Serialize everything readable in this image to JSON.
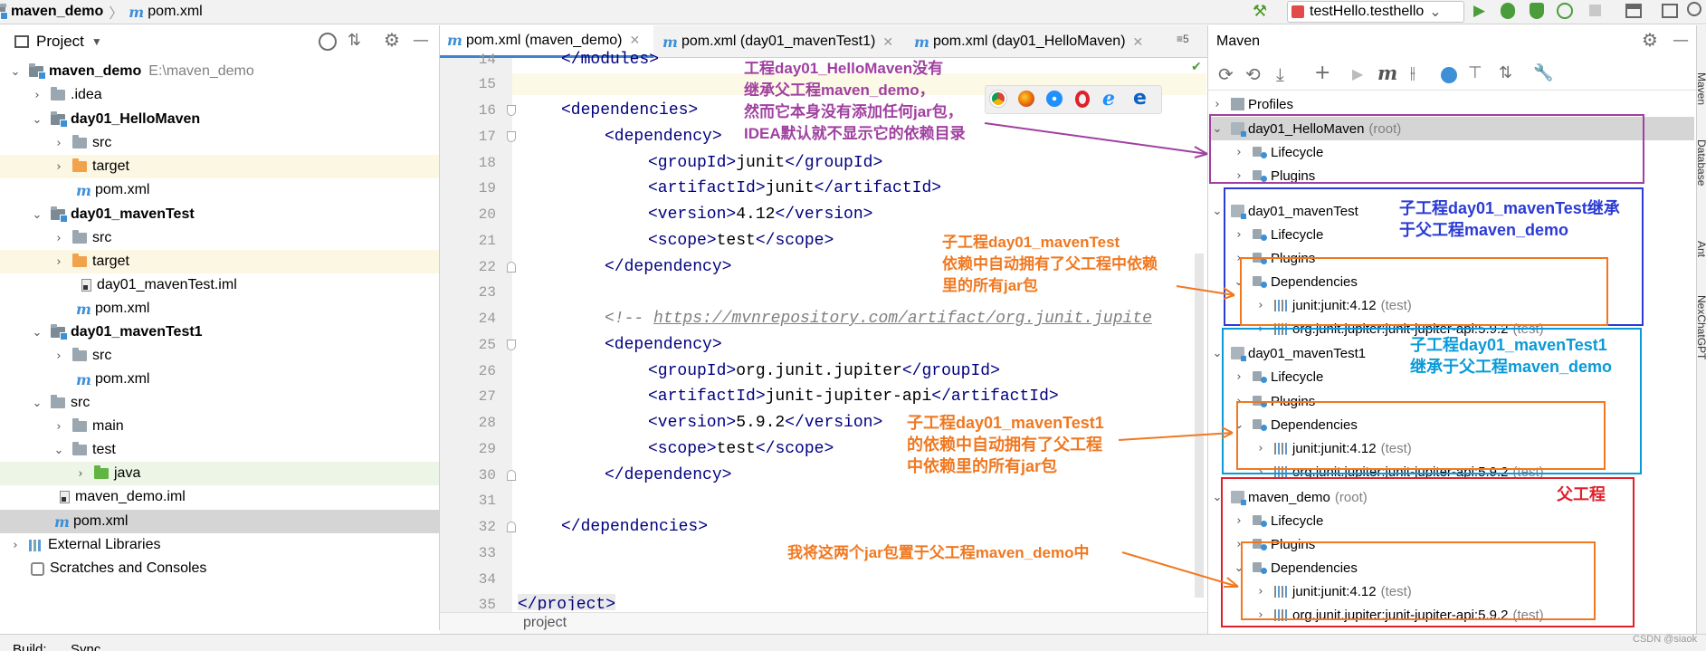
{
  "titlebar": {
    "project": "maven_demo",
    "file": "pom.xml",
    "run_config": "testHello.testhello"
  },
  "project_panel": {
    "title": "Project",
    "root_name": "maven_demo",
    "root_path": "E:\\maven_demo",
    "items": {
      "idea": ".idea",
      "hello": "day01_HelloMaven",
      "hello_src": "src",
      "hello_target": "target",
      "hello_pom": "pom.xml",
      "mt": "day01_mavenTest",
      "mt_src": "src",
      "mt_target": "target",
      "mt_iml": "day01_mavenTest.iml",
      "mt_pom": "pom.xml",
      "mt1": "day01_mavenTest1",
      "mt1_src": "src",
      "mt1_pom": "pom.xml",
      "src": "src",
      "main": "main",
      "test": "test",
      "java": "java",
      "demo_iml": "maven_demo.iml",
      "demo_pom": "pom.xml",
      "ext": "External Libraries",
      "scratch": "Scratches and Consoles"
    }
  },
  "editor": {
    "tabs": [
      "pom.xml (maven_demo)",
      "pom.xml (day01_mavenTest1)",
      "pom.xml (day01_HelloMaven)"
    ],
    "tab_overflow": "5",
    "breadcrumb": "project",
    "lines": {
      "n14": "14",
      "n15": "15",
      "n16": "16",
      "n17": "17",
      "n18": "18",
      "n19": "19",
      "n20": "20",
      "n21": "21",
      "n22": "22",
      "n23": "23",
      "n24": "24",
      "n25": "25",
      "n26": "26",
      "n27": "27",
      "n28": "28",
      "n29": "29",
      "n30": "30",
      "n31": "31",
      "n32": "32",
      "n33": "33",
      "n34": "34",
      "n35": "35"
    },
    "code": {
      "l14": "</modules>",
      "l16": "<dependencies>",
      "l17": "<dependency>",
      "l18_open": "<groupId>",
      "l18_val": "junit",
      "l18_close": "</groupId>",
      "l19_open": "<artifactId>",
      "l19_val": "junit",
      "l19_close": "</artifactId>",
      "l20_open": "<version>",
      "l20_val": "4.12",
      "l20_close": "</version>",
      "l21_open": "<scope>",
      "l21_val": "test",
      "l21_close": "</scope>",
      "l22": "</dependency>",
      "l24_prefix": "<!-- ",
      "l24_url": "https://mvnrepository.com/artifact/org.junit.jupite",
      "l25": "<dependency>",
      "l26_open": "<groupId>",
      "l26_val": "org.junit.jupiter",
      "l26_close": "</groupId>",
      "l27_open": "<artifactId>",
      "l27_val": "junit-jupiter-api",
      "l27_close": "</artifactId>",
      "l28_open": "<version>",
      "l28_val": "5.9.2",
      "l28_close": "</version>",
      "l29_open": "<scope>",
      "l29_val": "test",
      "l29_close": "</scope>",
      "l30": "</dependency>",
      "l32": "</dependencies>",
      "l35": "</project>"
    }
  },
  "maven": {
    "title": "Maven",
    "profiles": "Profiles",
    "hello": "day01_HelloMaven",
    "hello_root": "(root)",
    "hello_lifecycle": "Lifecycle",
    "hello_plugins": "Plugins",
    "mt": "day01_mavenTest",
    "mt_lifecycle": "Lifecycle",
    "mt_plugins": "Plugins",
    "mt_deps": "Dependencies",
    "mt_dep1": "junit:junit:4.12",
    "mt_dep1_scope": "(test)",
    "mt_dep2": "org.junit.jupiter:junit-jupiter-api:5.9.2",
    "mt_dep2_scope": "(test)",
    "mt1": "day01_mavenTest1",
    "mt1_lifecycle": "Lifecycle",
    "mt1_plugins": "Plugins",
    "mt1_deps": "Dependencies",
    "mt1_dep1": "junit:junit:4.12",
    "mt1_dep1_scope": "(test)",
    "mt1_dep2": "org.junit.jupiter:junit-jupiter-api:5.9.2",
    "mt1_dep2_scope": "(test)",
    "demo": "maven_demo",
    "demo_root": "(root)",
    "demo_lifecycle": "Lifecycle",
    "demo_plugins": "Plugins",
    "demo_deps": "Dependencies",
    "demo_dep1": "junit:junit:4.12",
    "demo_dep1_scope": "(test)",
    "demo_dep2": "org.junit.jupiter:junit-jupiter-api:5.9.2",
    "demo_dep2_scope": "(test)"
  },
  "side_tabs": [
    "Maven",
    "Database",
    "Ant",
    "NexChatGPT"
  ],
  "bottom_bar": {
    "build": "Build:",
    "sync": "Sync"
  },
  "annotations": {
    "hello": "工程day01_HelloMaven没有\n继承父工程maven_demo，\n然而它本身没有添加任何jar包，\nIDEA默认就不显示它的依赖目录",
    "mt_code": "子工程day01_mavenTest\n依赖中自动拥有了父工程中依赖\n里的所有jar包",
    "mt_right": "子工程day01_mavenTest继承\n于父工程maven_demo",
    "mt1_right": "子工程day01_mavenTest1\n继承于父工程maven_demo",
    "mt1_code": "子工程day01_mavenTest1\n的依赖中自动拥有了父工程\n中依赖里的所有jar包",
    "parent": "父工程",
    "demo_code": "我将这两个jar包置于父工程maven_demo中"
  },
  "watermark": "CSDN @siaok",
  "colors": {
    "purple": "#a040a0",
    "blue": "#2b3bd4",
    "cyan": "#0a9ad8",
    "red": "#e0202a",
    "orange": "#f07820"
  }
}
